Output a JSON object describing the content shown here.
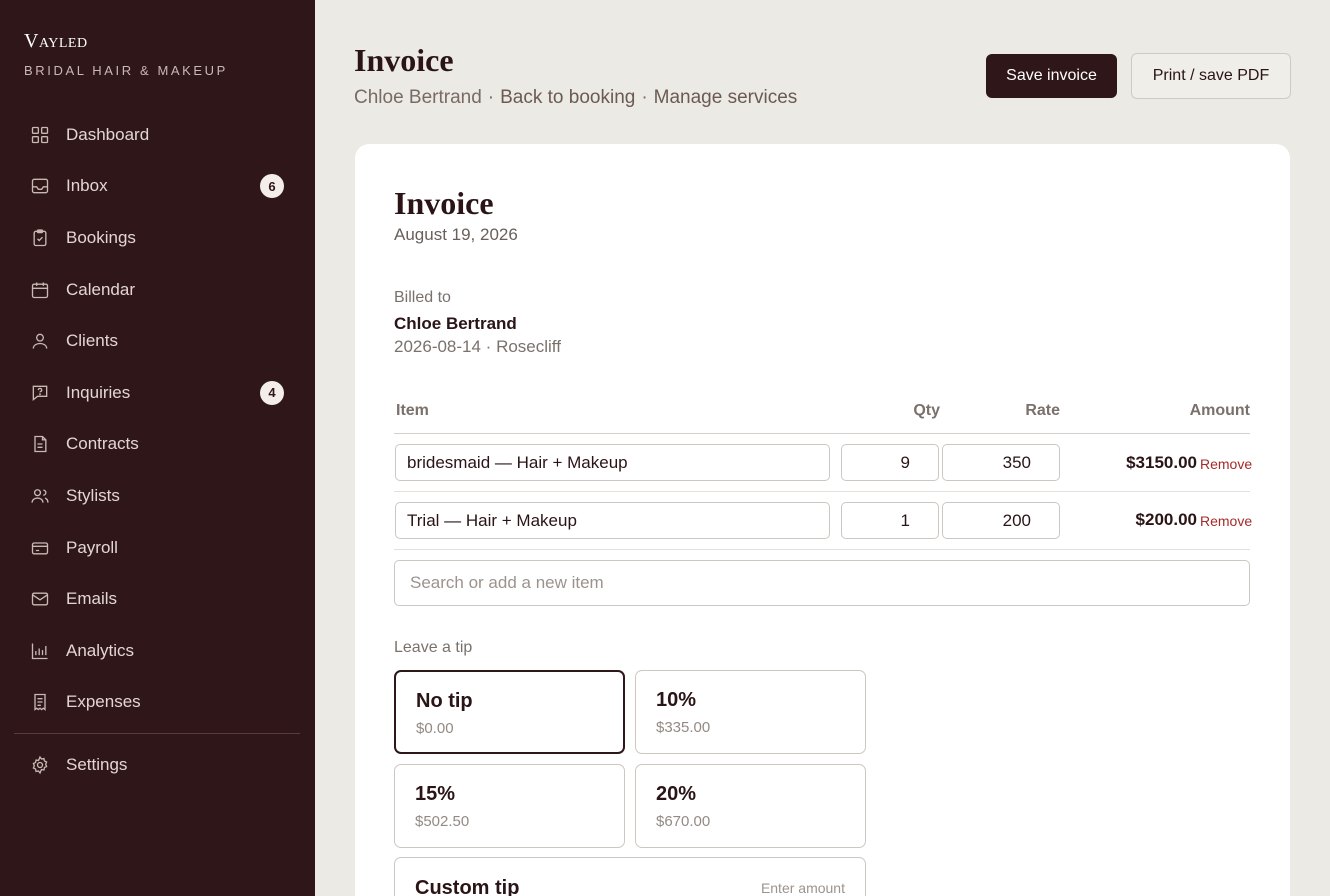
{
  "brand": {
    "name": "Vayled",
    "tagline": "BRIDAL HAIR & MAKEUP"
  },
  "sidebar": {
    "items": [
      {
        "label": "Dashboard",
        "icon": "grid-icon"
      },
      {
        "label": "Inbox",
        "icon": "inbox-icon",
        "badge": "6"
      },
      {
        "label": "Bookings",
        "icon": "clipboard-check-icon"
      },
      {
        "label": "Calendar",
        "icon": "calendar-icon"
      },
      {
        "label": "Clients",
        "icon": "user-icon"
      },
      {
        "label": "Inquiries",
        "icon": "message-question-icon",
        "badge": "4"
      },
      {
        "label": "Contracts",
        "icon": "document-icon"
      },
      {
        "label": "Stylists",
        "icon": "users-icon"
      },
      {
        "label": "Payroll",
        "icon": "wallet-icon"
      },
      {
        "label": "Emails",
        "icon": "mail-icon"
      },
      {
        "label": "Analytics",
        "icon": "bar-chart-icon"
      },
      {
        "label": "Expenses",
        "icon": "receipt-icon"
      }
    ],
    "settings": {
      "label": "Settings",
      "icon": "gear-icon"
    }
  },
  "header": {
    "title": "Invoice",
    "client": "Chloe Bertrand",
    "separator": "·",
    "back_link": "Back to booking",
    "manage_link": "Manage services",
    "save_label": "Save invoice",
    "print_label": "Print / save PDF"
  },
  "invoice": {
    "title": "Invoice",
    "date": "August 19, 2026",
    "billed_label": "Billed to",
    "billed_name": "Chloe Bertrand",
    "billed_info": "2026-08-14 · Rosecliff",
    "columns": {
      "item": "Item",
      "qty": "Qty",
      "rate": "Rate",
      "amount": "Amount"
    },
    "rows": [
      {
        "item": "bridesmaid — Hair + Makeup",
        "qty": "9",
        "rate": "350",
        "amount": "$3150.00",
        "remove": "Remove"
      },
      {
        "item": "Trial — Hair + Makeup",
        "qty": "1",
        "rate": "200",
        "amount": "$200.00",
        "remove": "Remove"
      }
    ],
    "search_placeholder": "Search or add a new item",
    "tip": {
      "label": "Leave a tip",
      "options": [
        {
          "name": "No tip",
          "amount": "$0.00",
          "selected": true
        },
        {
          "name": "10%",
          "amount": "$335.00",
          "selected": false
        },
        {
          "name": "15%",
          "amount": "$502.50",
          "selected": false
        },
        {
          "name": "20%",
          "amount": "$670.00",
          "selected": false
        }
      ],
      "custom_label": "Custom tip",
      "custom_placeholder": "Enter amount"
    }
  },
  "colors": {
    "sidebar_bg": "#2f1618",
    "accent": "#2f1618",
    "page_bg": "#ebeae5",
    "remove": "#a52a2a"
  }
}
